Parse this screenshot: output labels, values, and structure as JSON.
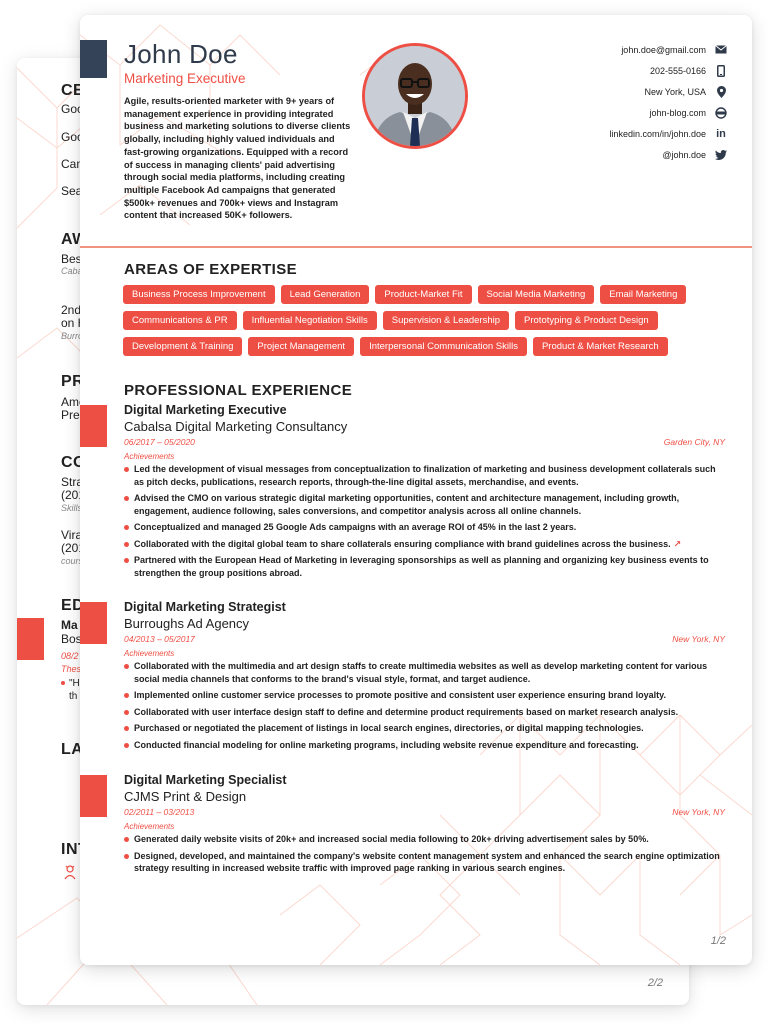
{
  "colors": {
    "accent": "#ee4f45",
    "dark_block": "#344357",
    "divider": "#f0937f",
    "text": "#222222"
  },
  "page_back": {
    "page_number": "2/2",
    "sections": [
      {
        "heading": "CE",
        "items": [
          "Goo",
          "Goo",
          "Cam",
          "Sea"
        ]
      },
      {
        "heading": "AW",
        "items": [
          {
            "title": "Best",
            "sub": "Caba"
          },
          {
            "title": "2nd",
            "title2": "on H",
            "sub": "Burro"
          }
        ]
      },
      {
        "heading": "PR",
        "items": [
          "Ame",
          "Pres"
        ]
      },
      {
        "heading": "CO",
        "items": [
          {
            "title": "Stra",
            "title2": "(201",
            "sub": "Skills"
          },
          {
            "title": "Vira",
            "title2": "(201",
            "sub": "cours"
          }
        ]
      },
      {
        "heading": "ED",
        "items": [
          {
            "title": "Ma",
            "title2": "Bos",
            "dates": "08/2",
            "label": "Thes",
            "bullet": "\"H",
            "bullet2": "th"
          }
        ]
      },
      {
        "heading": "LA",
        "items": []
      },
      {
        "heading": "INT",
        "items": [],
        "icon": "person-icon"
      }
    ]
  },
  "header": {
    "name": "John Doe",
    "role": "Marketing Executive",
    "summary": "Agile, results-oriented marketer with 9+ years of management experience in providing integrated business and marketing solutions to diverse clients globally, including highly valued individuals and fast-growing organizations. Equipped with a record of success in managing clients' paid advertising through social media platforms, including creating multiple Facebook Ad campaigns that generated $500k+ revenues and 700k+ views and Instagram content that increased 50K+ followers.",
    "photo_alt": "Profile photo of John Doe"
  },
  "contacts": [
    {
      "text": "john.doe@gmail.com",
      "icon": "email-icon"
    },
    {
      "text": "202-555-0166",
      "icon": "phone-icon"
    },
    {
      "text": "New York, USA",
      "icon": "location-pin-icon"
    },
    {
      "text": "john-blog.com",
      "icon": "globe-icon"
    },
    {
      "text": "linkedin.com/in/john.doe",
      "icon": "linkedin-icon"
    },
    {
      "text": "@john.doe",
      "icon": "twitter-icon"
    }
  ],
  "expertise": {
    "title": "AREAS OF EXPERTISE",
    "rows": [
      [
        "Business Process Improvement",
        "Lead Generation",
        "Product-Market Fit",
        "Social Media Marketing",
        "Email Marketing"
      ],
      [
        "Communications & PR",
        "Influential Negotiation Skills",
        "Supervision & Leadership",
        "Prototyping & Product Design"
      ],
      [
        "Development & Training",
        "Project Management",
        "Interpersonal Communication Skills",
        "Product & Market Research"
      ]
    ]
  },
  "experience": {
    "title": "PROFESSIONAL EXPERIENCE",
    "achievements_label": "Achievements",
    "jobs": [
      {
        "title": "Digital Marketing Executive",
        "company": "Cabalsa Digital Marketing Consultancy",
        "dates": "06/2017 – 05/2020",
        "location": "Garden City, NY",
        "bullets": [
          "Led the development of visual messages from conceptualization to finalization of marketing and business development collaterals such as pitch decks, publications, research reports, through-the-line digital assets, merchandise, and events.",
          "Advised the CMO on various strategic digital marketing opportunities, content and architecture management, including growth, engagement, audience following, sales conversions, and competitor analysis across all online channels.",
          "Conceptualized and managed 25 Google Ads campaigns with an average ROI of 45% in the last 2 years.",
          "Collaborated with the digital global team to share collaterals ensuring compliance with brand guidelines across the business.",
          "Partnered with the European Head of Marketing in leveraging sponsorships as well as planning and organizing key business events to strengthen the group positions abroad."
        ],
        "link_bullet_index": 3
      },
      {
        "title": "Digital Marketing Strategist",
        "company": "Burroughs Ad Agency",
        "dates": "04/2013 – 05/2017",
        "location": "New York, NY",
        "bullets": [
          "Collaborated with the multimedia and art design staffs to create multimedia websites as well as develop marketing content for various social media channels that conforms to the brand's visual style, format, and target audience.",
          "Implemented online customer service processes to promote positive and consistent user experience ensuring brand loyalty.",
          "Collaborated with user interface design staff to define and determine product requirements based on market research analysis.",
          "Purchased or negotiated the placement of listings in local search engines, directories, or digital mapping technologies.",
          "Conducted financial modeling for online marketing programs, including website revenue expenditure and forecasting."
        ]
      },
      {
        "title": "Digital Marketing Specialist",
        "company": "CJMS Print & Design",
        "dates": "02/2011 – 03/2013",
        "location": "New York, NY",
        "bullets": [
          "Generated daily website visits of 20k+ and increased social media following to 20k+ driving advertisement sales by 50%.",
          "Designed, developed, and maintained the company's website content management system and enhanced the search engine optimization strategy resulting in increased website traffic with improved page ranking in various search engines."
        ]
      }
    ]
  },
  "page_front": {
    "page_number": "1/2"
  }
}
